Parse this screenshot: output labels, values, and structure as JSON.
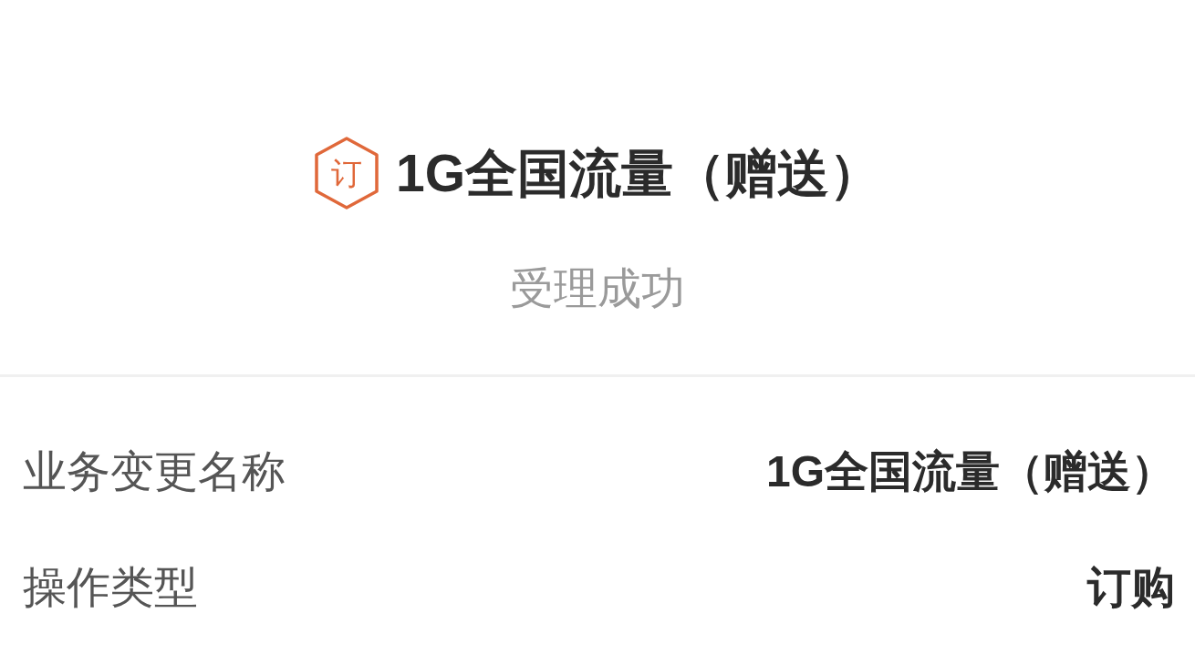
{
  "order": {
    "badge": "订",
    "title": "1G全国流量（赠送）",
    "status": "受理成功"
  },
  "details": [
    {
      "label": "业务变更名称",
      "value": "1G全国流量（赠送）"
    },
    {
      "label": "操作类型",
      "value": "订购"
    }
  ]
}
